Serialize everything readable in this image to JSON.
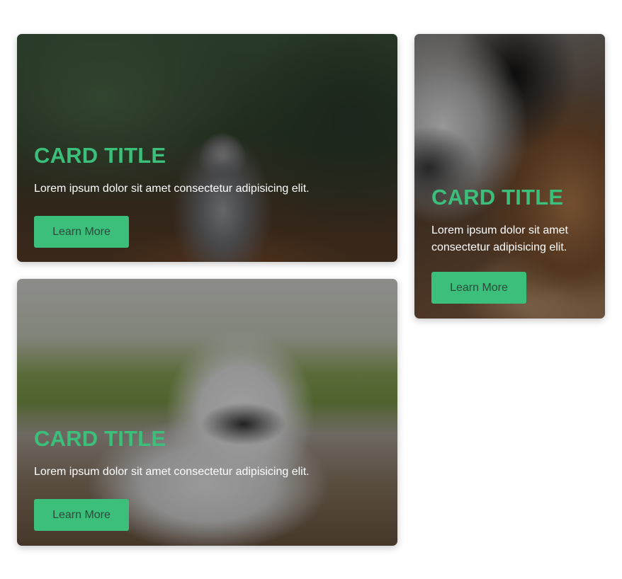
{
  "colors": {
    "accent": "#3bbf7a",
    "button_text": "#2b4a3a",
    "text": "#ffffff"
  },
  "cards": [
    {
      "title": "CARD TITLE",
      "text": "Lorem ipsum dolor sit amet consectetur adipisicing elit.",
      "button_label": "Learn More"
    },
    {
      "title": "CARD TITLE",
      "text": "Lorem ipsum dolor sit amet consectetur adipisicing elit.",
      "button_label": "Learn More"
    },
    {
      "title": "CARD TITLE",
      "text": "Lorem ipsum dolor sit amet consectetur adipisicing elit.",
      "button_label": "Learn More"
    }
  ]
}
